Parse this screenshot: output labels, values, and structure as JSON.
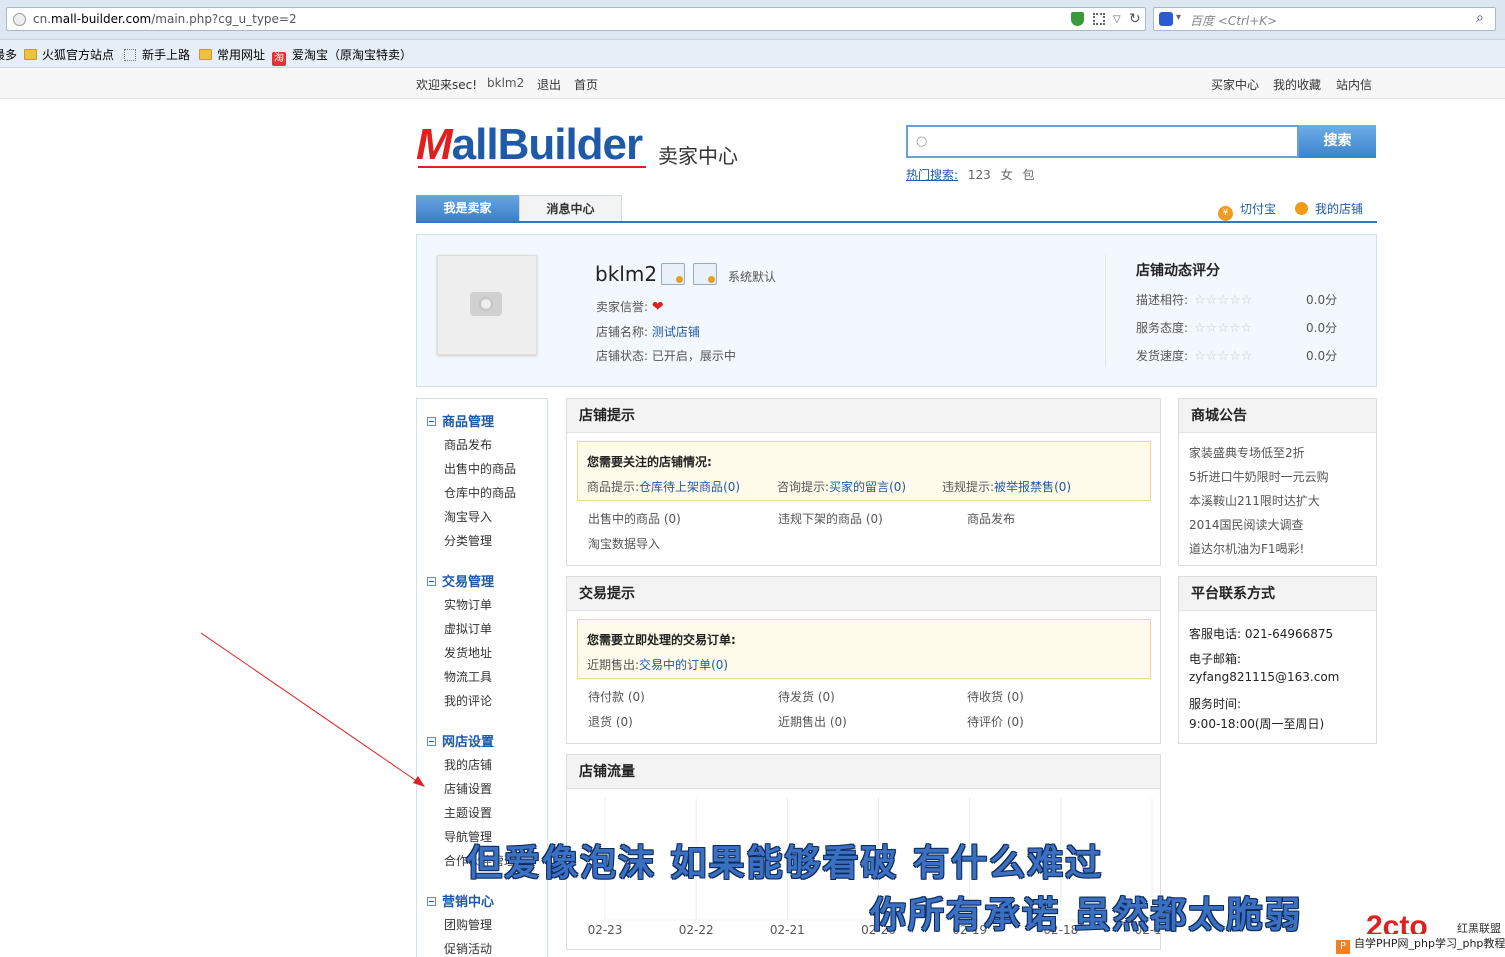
{
  "browser": {
    "url_prefix": "cn.",
    "url_domain": "mall-builder.com",
    "url_path": "/main.php?cg_u_type=2",
    "search_hint": "百度 <Ctrl+K>",
    "bookmarks": [
      "最多",
      "火狐官方站点",
      "新手上路",
      "常用网址",
      "爱淘宝（原淘宝特卖）"
    ],
    "taobao_icon": "淘"
  },
  "topnav": {
    "welcome": "欢迎来sec!",
    "user": "bklm2",
    "logout": "退出",
    "home": "首页",
    "buyer_center": "买家中心",
    "favorites": "我的收藏",
    "messages": "站内信"
  },
  "header": {
    "logo_m": "M",
    "logo_all": "all",
    "logo_builder": "Builder",
    "subtitle": "卖家中心",
    "search_button": "搜索",
    "hot_label": "热门搜索:",
    "hot_keywords": [
      "123",
      "女",
      "包"
    ]
  },
  "tabs": {
    "seller": "我是卖家",
    "messages": "消息中心",
    "link_pay": "切付宝",
    "link_shop": "我的店铺",
    "coin_glyph": "¥"
  },
  "shop": {
    "name": "bklm2",
    "sys_default": "系统默认",
    "credit_label": "卖家信誉:",
    "name_label": "店铺名称:",
    "name_value": "测试店铺",
    "status_label": "店铺状态:",
    "status_value": "已开启，展示中"
  },
  "ratings": {
    "title": "店铺动态评分",
    "rows": [
      {
        "label": "描述相符:",
        "value": "0.0分"
      },
      {
        "label": "服务态度:",
        "value": "0.0分"
      },
      {
        "label": "发货速度:",
        "value": "0.0分"
      }
    ]
  },
  "sidebar": {
    "sections": [
      {
        "title": "商品管理",
        "items": [
          "商品发布",
          "出售中的商品",
          "仓库中的商品",
          "淘宝导入",
          "分类管理"
        ]
      },
      {
        "title": "交易管理",
        "items": [
          "实物订单",
          "虚拟订单",
          "发货地址",
          "物流工具",
          "我的评论"
        ]
      },
      {
        "title": "网店设置",
        "items": [
          "我的店铺",
          "店铺设置",
          "主题设置",
          "导航管理",
          "合作伙伴管理"
        ]
      },
      {
        "title": "营销中心",
        "items": [
          "团购管理",
          "促销活动"
        ]
      }
    ]
  },
  "shop_tips": {
    "title": "店铺提示",
    "notice_title": "您需要关注的店铺情况:",
    "tips": [
      {
        "label": "商品提示:",
        "link": "仓库待上架商品",
        "count": "(0)"
      },
      {
        "label": "咨询提示:",
        "link": "买家的留言",
        "count": "(0)"
      },
      {
        "label": "违规提示:",
        "link": "被举报禁售",
        "count": "(0)"
      }
    ],
    "stats": [
      "出售中的商品 (0)",
      "违规下架的商品 (0)",
      "商品发布",
      "淘宝数据导入"
    ]
  },
  "trade_tips": {
    "title": "交易提示",
    "notice_title": "您需要立即处理的交易订单:",
    "tip_label": "近期售出:",
    "tip_link": "交易中的订单",
    "tip_count": "(0)",
    "stats": [
      "待付款 (0)",
      "待发货 (0)",
      "待收货 (0)",
      "退货 (0)",
      "近期售出 (0)",
      "待评价 (0)"
    ]
  },
  "traffic": {
    "title": "店铺流量"
  },
  "chart_data": {
    "type": "line",
    "title": "店铺流量",
    "categories": [
      "02-23",
      "02-22",
      "02-21",
      "02-20",
      "02-19",
      "02-18",
      "02-17"
    ],
    "series": [
      {
        "values": [
          0,
          0,
          0,
          0,
          0,
          0,
          0
        ]
      }
    ],
    "grid": true
  },
  "announcements": {
    "title": "商城公告",
    "items": [
      "家装盛典专场低至2折",
      "5折进口牛奶限时一元云购",
      "本溪鞍山211限时达扩大",
      "2014国民阅读大调查",
      "道达尔机油为F1喝彩!"
    ]
  },
  "contact": {
    "title": "平台联系方式",
    "phone": "客服电话: 021-64966875",
    "email_label": "电子邮箱:",
    "email": "zyfang821115@163.com",
    "hours_label": "服务时间:",
    "hours": "9:00-18:00(周一至周日)"
  },
  "overlay": {
    "lyric1": "但爱像泡沫   如果能够看破   有什么难过",
    "lyric2": "你所有承诺   虽然都太脆弱",
    "wm_logo": "2cto",
    "wm_small": "红黑联盟",
    "wm_strip": "自学PHP网_php学习_php教程",
    "wm_p": "P",
    "annotation_color": "#e02020"
  }
}
